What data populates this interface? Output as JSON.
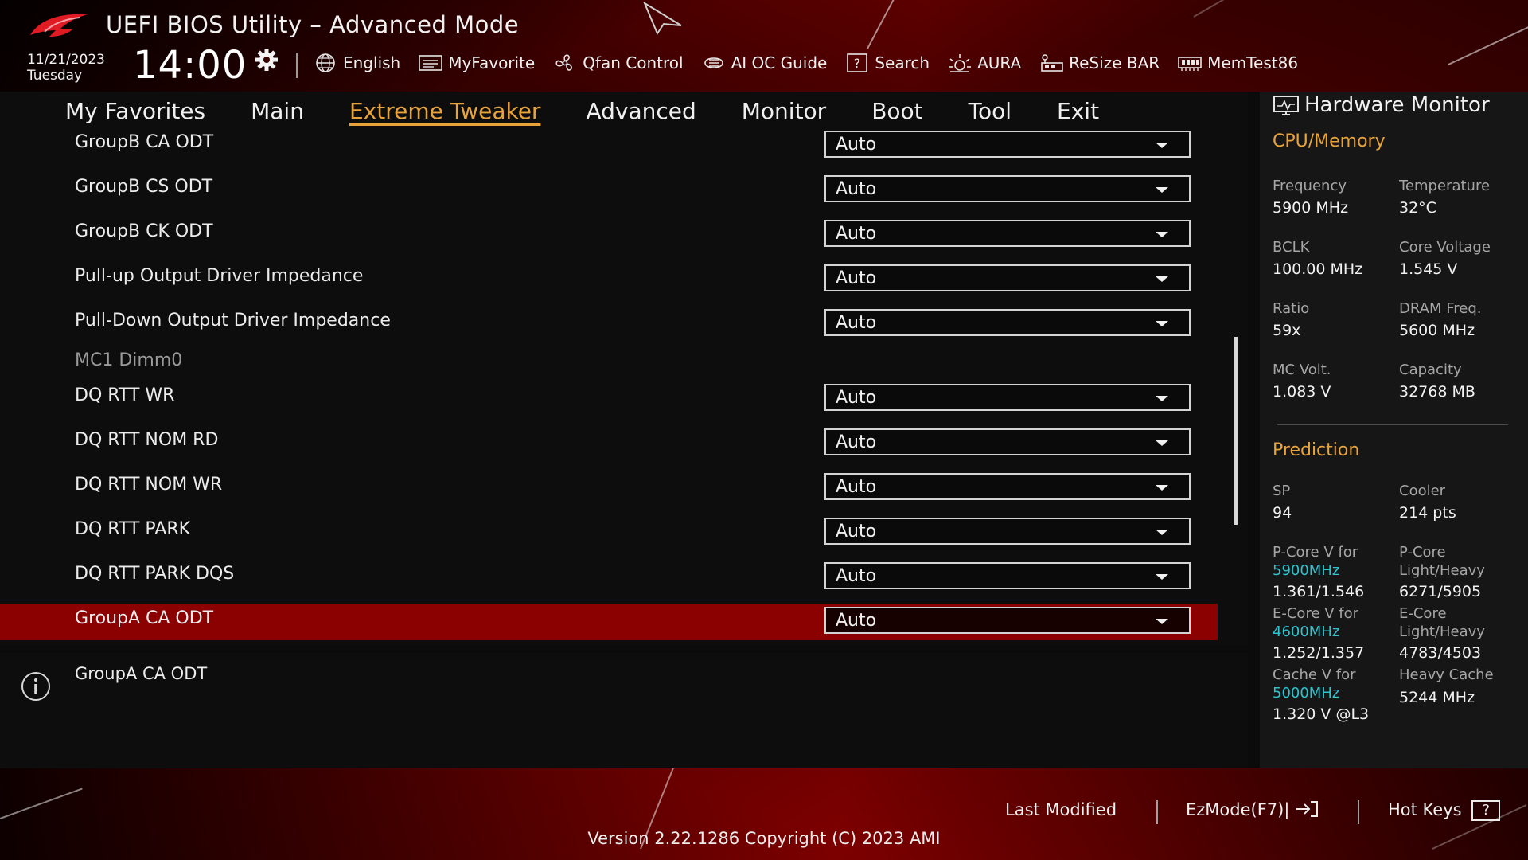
{
  "header": {
    "title": "UEFI BIOS Utility – Advanced Mode",
    "date": "11/21/2023",
    "day": "Tuesday",
    "time": "14:00"
  },
  "toolbar": [
    {
      "label": "English",
      "icon": "globe-icon"
    },
    {
      "label": "MyFavorite",
      "icon": "favorite-list-icon"
    },
    {
      "label": "Qfan Control",
      "icon": "fan-icon"
    },
    {
      "label": "AI OC Guide",
      "icon": "ai-chip-icon"
    },
    {
      "label": "Search",
      "icon": "help-search-icon"
    },
    {
      "label": "AURA",
      "icon": "aura-light-icon"
    },
    {
      "label": "ReSize BAR",
      "icon": "resize-bar-icon"
    },
    {
      "label": "MemTest86",
      "icon": "memory-icon"
    }
  ],
  "nav": {
    "tabs": [
      "My Favorites",
      "Main",
      "Extreme Tweaker",
      "Advanced",
      "Monitor",
      "Boot",
      "Tool",
      "Exit"
    ],
    "active": "Extreme Tweaker"
  },
  "settings": [
    {
      "label": "GroupB CA ODT",
      "value": "Auto"
    },
    {
      "label": "GroupB CS ODT",
      "value": "Auto"
    },
    {
      "label": "GroupB CK ODT",
      "value": "Auto"
    },
    {
      "label": "Pull-up Output Driver Impedance",
      "value": "Auto"
    },
    {
      "label": "Pull-Down Output Driver Impedance",
      "value": "Auto"
    },
    {
      "section": "MC1 Dimm0"
    },
    {
      "label": "DQ RTT WR",
      "value": "Auto"
    },
    {
      "label": "DQ RTT NOM RD",
      "value": "Auto"
    },
    {
      "label": "DQ RTT NOM WR",
      "value": "Auto"
    },
    {
      "label": "DQ RTT PARK",
      "value": "Auto"
    },
    {
      "label": "DQ RTT PARK DQS",
      "value": "Auto"
    },
    {
      "label": "GroupA CA ODT",
      "value": "Auto",
      "selected": true
    }
  ],
  "info": {
    "text": "GroupA CA ODT"
  },
  "hardware_monitor": {
    "title": "Hardware Monitor",
    "cpu_memory": {
      "title": "CPU/Memory",
      "items": [
        {
          "label": "Frequency",
          "value": "5900 MHz"
        },
        {
          "label": "Temperature",
          "value": "32°C"
        },
        {
          "label": "BCLK",
          "value": "100.00 MHz"
        },
        {
          "label": "Core Voltage",
          "value": "1.545 V"
        },
        {
          "label": "Ratio",
          "value": "59x"
        },
        {
          "label": "DRAM Freq.",
          "value": "5600 MHz"
        },
        {
          "label": "MC Volt.",
          "value": "1.083 V"
        },
        {
          "label": "Capacity",
          "value": "32768 MB"
        }
      ]
    },
    "prediction": {
      "title": "Prediction",
      "sp_label": "SP",
      "sp_value": "94",
      "cooler_label": "Cooler",
      "cooler_value": "214 pts",
      "pcore_v_label": "P-Core V for",
      "pcore_v_freq": "5900MHz",
      "pcore_v_value": "1.361/1.546",
      "pcore_lh_label1": "P-Core",
      "pcore_lh_label2": "Light/Heavy",
      "pcore_lh_value": "6271/5905",
      "ecore_v_label": "E-Core V for",
      "ecore_v_freq": "4600MHz",
      "ecore_v_value": "1.252/1.357",
      "ecore_lh_label1": "E-Core",
      "ecore_lh_label2": "Light/Heavy",
      "ecore_lh_value": "4783/4503",
      "cache_v_label": "Cache V for",
      "cache_v_freq": "5000MHz",
      "cache_v_value": "1.320 V @L3",
      "heavy_cache_label": "Heavy Cache",
      "heavy_cache_value": "5244 MHz"
    }
  },
  "footer": {
    "last_modified": "Last Modified",
    "ezmode": "EzMode(F7)|",
    "hotkeys": "Hot Keys",
    "hotkeys_key": "?",
    "version": "Version 2.22.1286 Copyright (C) 2023 AMI"
  },
  "colors": {
    "accent": "#e8a33a",
    "selected_row": "#8b0000",
    "cyan": "#2bc5d0"
  }
}
